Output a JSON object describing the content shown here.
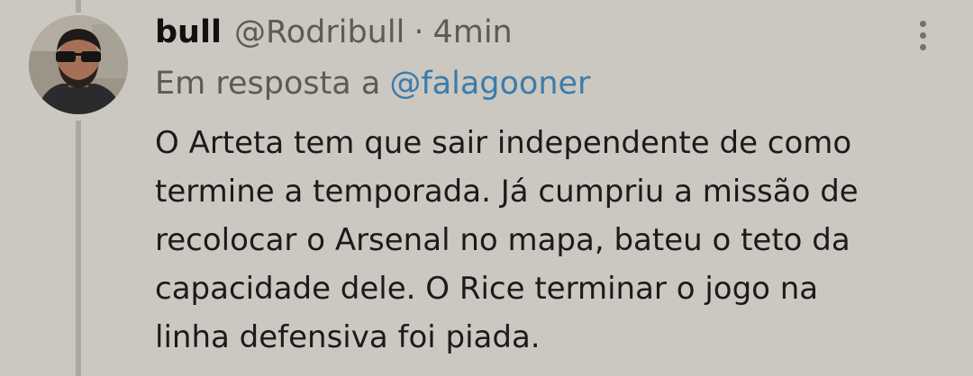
{
  "tweet": {
    "author": {
      "display_name": "bull",
      "handle": "@Rodribull",
      "avatar_icon": "profile-photo-sunglasses"
    },
    "separator": "·",
    "time": "4min",
    "reply": {
      "prefix": "Em resposta a",
      "mention": "@falagooner"
    },
    "text_lines": [
      "O Arteta tem que sair independente de como",
      "termine a temporada. Já cumpriu a missão de",
      "recolocar o Arsenal no mapa, bateu o teto da",
      "capacidade dele. O Rice terminar o jogo na",
      "linha defensiva foi piada."
    ],
    "menu_icon": "more-vertical-icon"
  },
  "colors": {
    "background": "#cac8c1",
    "mention": "#3b7cac",
    "muted_text": "#5c5b57",
    "thread_line": "#a9a8a2"
  }
}
